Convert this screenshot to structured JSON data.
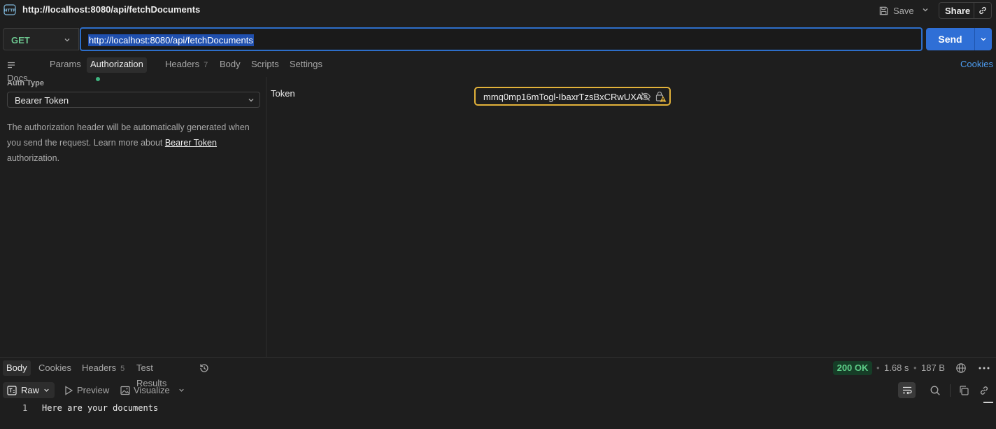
{
  "header": {
    "icon_name": "http-icon",
    "title": "http://localhost:8080/api/fetchDocuments",
    "save_label": "Save",
    "share_label": "Share"
  },
  "request": {
    "method": "GET",
    "url": "http://localhost:8080/api/fetchDocuments",
    "send_label": "Send",
    "tabs": [
      {
        "label": "Docs"
      },
      {
        "label": "Params"
      },
      {
        "label": "Authorization",
        "active": true,
        "indicator": "green-dot"
      },
      {
        "label": "Headers",
        "count": "7"
      },
      {
        "label": "Body"
      },
      {
        "label": "Scripts"
      },
      {
        "label": "Settings"
      }
    ],
    "cookies_label": "Cookies"
  },
  "auth": {
    "type_label": "Auth Type",
    "type_value": "Bearer Token",
    "desc_part1": "The authorization header will be automatically generated when you send the request. Learn more about ",
    "desc_link": "Bearer Token",
    "desc_part2": " authorization.",
    "token_label": "Token",
    "token_value": "mmq0mp16mTogl-IbaxrTzsBxCRwUXA"
  },
  "response": {
    "tabs": [
      {
        "label": "Body",
        "active": true
      },
      {
        "label": "Cookies"
      },
      {
        "label": "Headers",
        "count": "5"
      },
      {
        "label": "Test Results"
      }
    ],
    "status": "200 OK",
    "time": "1.68 s",
    "size": "187 B",
    "format_label": "Raw",
    "preview_label": "Preview",
    "visualize_label": "Visualize",
    "lines": [
      {
        "num": "1",
        "text": "Here are your documents"
      }
    ]
  },
  "colors": {
    "accent": "#2f6fd6",
    "method_get": "#6cc58f",
    "token_warning_border": "#e2b23a",
    "status_ok": "#5fd08a"
  }
}
